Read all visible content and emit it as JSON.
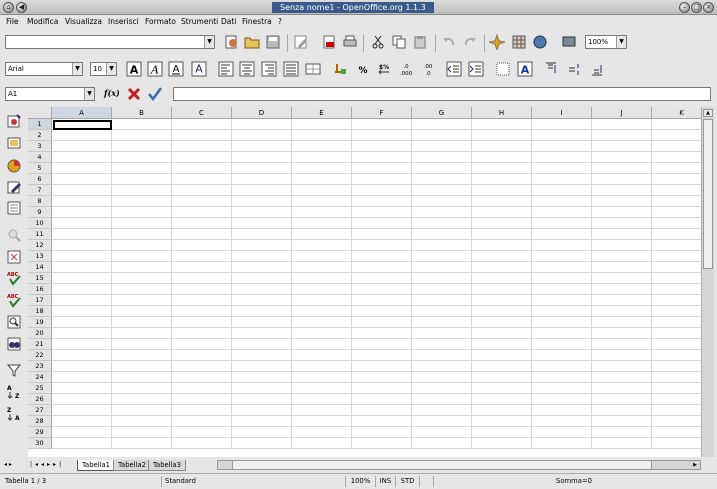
{
  "window": {
    "title": "Senza nome1 - OpenOffice.org 1.1.3"
  },
  "menu": [
    "File",
    "Modifica",
    "Visualizza",
    "Inserisci",
    "Formato",
    "Strumenti",
    "Dati",
    "Finestra",
    "?"
  ],
  "toolbar": {
    "url_value": "",
    "zoom": "100%"
  },
  "format": {
    "font": "Arial",
    "size": "10"
  },
  "formula": {
    "cell_ref": "A1",
    "fx": "f(x)",
    "content": ""
  },
  "columns": [
    "A",
    "B",
    "C",
    "D",
    "E",
    "F",
    "G",
    "H",
    "I",
    "J",
    "K"
  ],
  "rows": [
    "1",
    "2",
    "3",
    "4",
    "5",
    "6",
    "7",
    "8",
    "9",
    "10",
    "11",
    "12",
    "13",
    "14",
    "15",
    "16",
    "17",
    "18",
    "19",
    "20",
    "21",
    "22",
    "23",
    "24",
    "25",
    "26",
    "27",
    "28",
    "29",
    "30"
  ],
  "sheets": [
    "Tabella1",
    "Tabella2",
    "Tabella3"
  ],
  "status": {
    "sheet": "Tabella 1 / 3",
    "style": "Standard",
    "zoom": "100%",
    "mode": "INS",
    "sel": "STD",
    "sum": "Somma=0"
  }
}
